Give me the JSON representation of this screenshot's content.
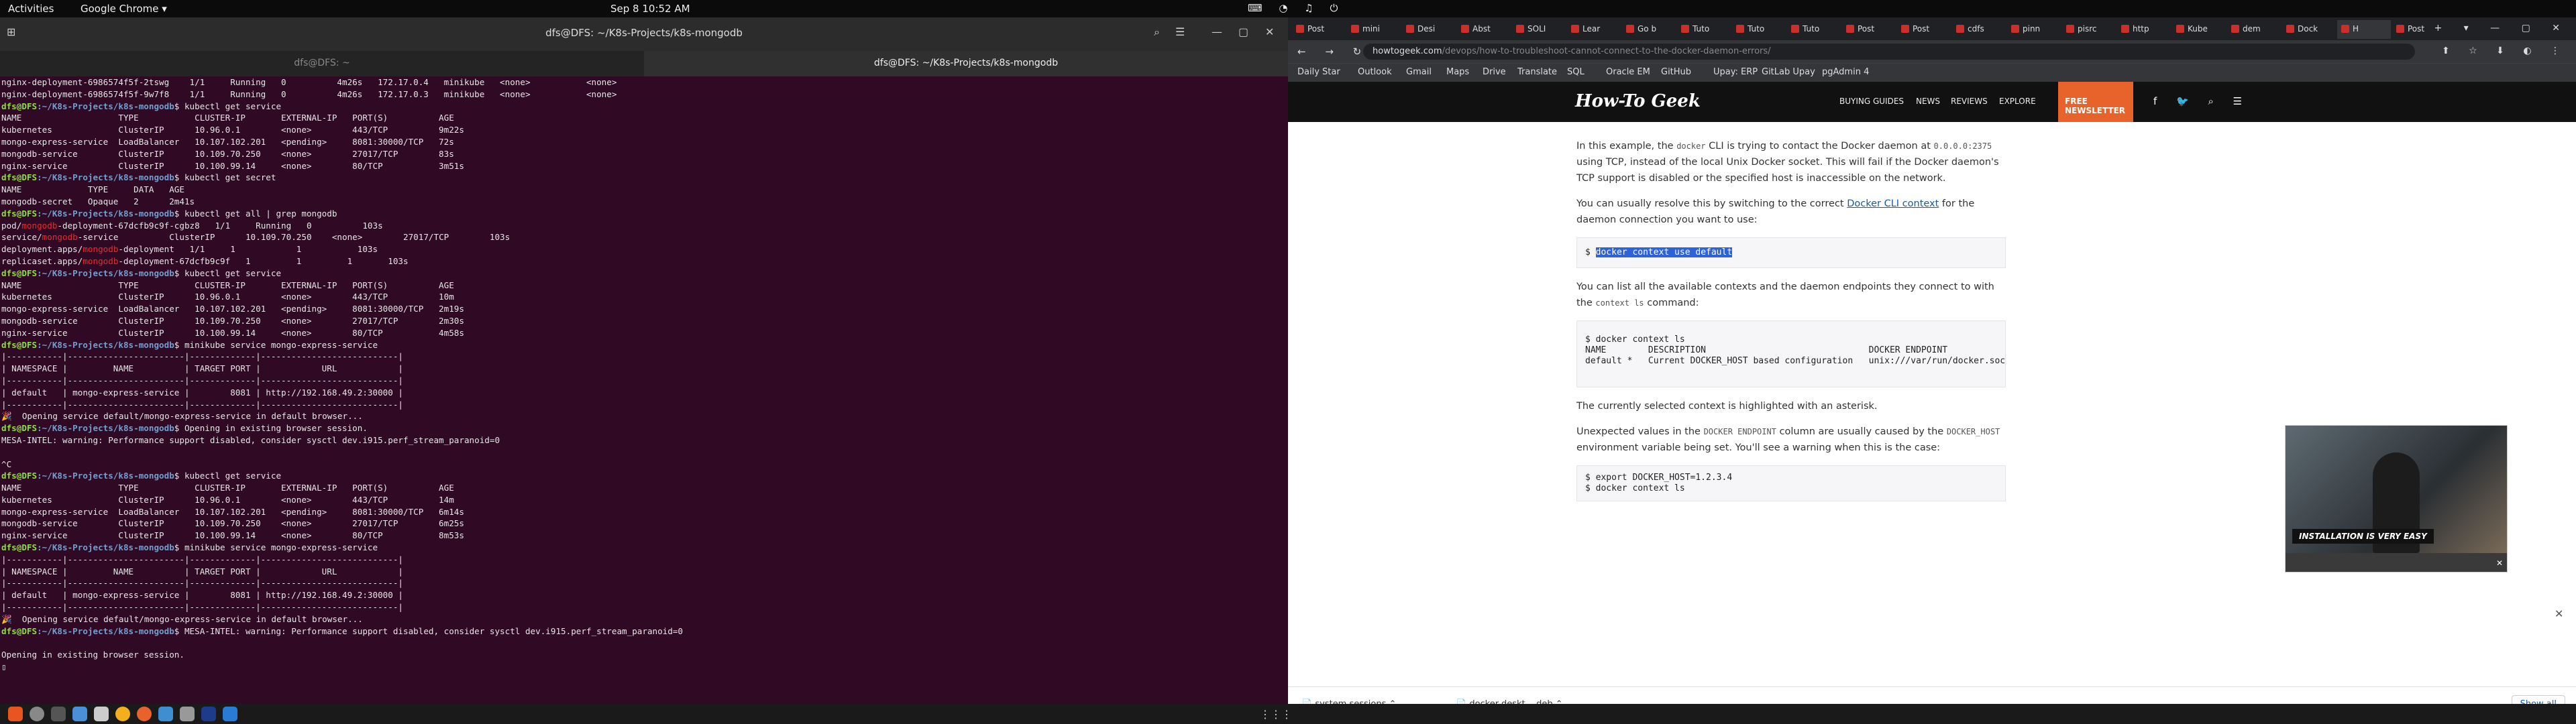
{
  "topbar": {
    "activities": "Activities",
    "app": "Google Chrome ▾",
    "clock": "Sep 8  10:52 AM"
  },
  "terminal": {
    "title": "dfs@DFS: ~/K8s-Projects/k8s-mongodb",
    "tab1": "dfs@DFS: ~",
    "tab2": "dfs@DFS: ~/K8s-Projects/k8s-mongodb",
    "lines": [
      {
        "t": "nginx-deployment-6986574f5f-2tswg    1/1     Running   0          4m26s   172.17.0.4   minikube   <none>           <none>"
      },
      {
        "t": "nginx-deployment-6986574f5f-9w7f8    1/1     Running   0          4m26s   172.17.0.3   minikube   <none>           <none>"
      },
      {
        "p": "kubectl get service"
      },
      {
        "t": "NAME                   TYPE           CLUSTER-IP       EXTERNAL-IP   PORT(S)          AGE"
      },
      {
        "t": "kubernetes             ClusterIP      10.96.0.1        <none>        443/TCP          9m22s"
      },
      {
        "t": "mongo-express-service  LoadBalancer   10.107.102.201   <pending>     8081:30000/TCP   72s"
      },
      {
        "t": "mongodb-service        ClusterIP      10.109.70.250    <none>        27017/TCP        83s"
      },
      {
        "t": "nginx-service          ClusterIP      10.100.99.14     <none>        80/TCP           3m51s"
      },
      {
        "p": "kubectl get secret"
      },
      {
        "t": "NAME             TYPE     DATA   AGE"
      },
      {
        "t": "mongodb-secret   Opaque   2      2m41s"
      },
      {
        "p": "kubectl get all | grep mongodb"
      },
      {
        "a": "pod/",
        "h": "mongodb",
        "b": "-deployment-67dcfb9c9f-cgbz8   1/1     Running   0          103s"
      },
      {
        "a": "service/",
        "h": "mongodb",
        "b": "-service          ClusterIP      10.109.70.250    <none>        27017/TCP        103s"
      },
      {
        "a": "deployment.apps/",
        "h": "mongodb",
        "b": "-deployment   1/1     1            1           103s"
      },
      {
        "a": "replicaset.apps/",
        "h": "mongodb",
        "b": "-deployment-67dcfb9c9f   1         1         1       103s"
      },
      {
        "p": "kubectl get service"
      },
      {
        "t": "NAME                   TYPE           CLUSTER-IP       EXTERNAL-IP   PORT(S)          AGE"
      },
      {
        "t": "kubernetes             ClusterIP      10.96.0.1        <none>        443/TCP          10m"
      },
      {
        "t": "mongo-express-service  LoadBalancer   10.107.102.201   <pending>     8081:30000/TCP   2m19s"
      },
      {
        "t": "mongodb-service        ClusterIP      10.109.70.250    <none>        27017/TCP        2m30s"
      },
      {
        "t": "nginx-service          ClusterIP      10.100.99.14     <none>        80/TCP           4m58s"
      },
      {
        "p": "minikube service mongo-express-service"
      },
      {
        "t": "|-----------|-----------------------|-------------|---------------------------|"
      },
      {
        "t": "| NAMESPACE |         NAME          | TARGET PORT |            URL            |"
      },
      {
        "t": "|-----------|-----------------------|-------------|---------------------------|"
      },
      {
        "t": "| default   | mongo-express-service |        8081 | http://192.168.49.2:30000 |"
      },
      {
        "t": "|-----------|-----------------------|-------------|---------------------------|"
      },
      {
        "t": "🎉  Opening service default/mongo-express-service in default browser..."
      },
      {
        "p": "Opening in existing browser session."
      },
      {
        "t": "MESA-INTEL: warning: Performance support disabled, consider sysctl dev.i915.perf_stream_paranoid=0"
      },
      {
        "t": ""
      },
      {
        "t": "^C"
      },
      {
        "p": "kubectl get service"
      },
      {
        "t": "NAME                   TYPE           CLUSTER-IP       EXTERNAL-IP   PORT(S)          AGE"
      },
      {
        "t": "kubernetes             ClusterIP      10.96.0.1        <none>        443/TCP          14m"
      },
      {
        "t": "mongo-express-service  LoadBalancer   10.107.102.201   <pending>     8081:30000/TCP   6m14s"
      },
      {
        "t": "mongodb-service        ClusterIP      10.109.70.250    <none>        27017/TCP        6m25s"
      },
      {
        "t": "nginx-service          ClusterIP      10.100.99.14     <none>        80/TCP           8m53s"
      },
      {
        "p": "minikube service mongo-express-service"
      },
      {
        "t": "|-----------|-----------------------|-------------|---------------------------|"
      },
      {
        "t": "| NAMESPACE |         NAME          | TARGET PORT |            URL            |"
      },
      {
        "t": "|-----------|-----------------------|-------------|---------------------------|"
      },
      {
        "t": "| default   | mongo-express-service |        8081 | http://192.168.49.2:30000 |"
      },
      {
        "t": "|-----------|-----------------------|-------------|---------------------------|"
      },
      {
        "t": "🎉  Opening service default/mongo-express-service in default browser..."
      },
      {
        "p": "MESA-INTEL: warning: Performance support disabled, consider sysctl dev.i915.perf_stream_paranoid=0"
      },
      {
        "t": ""
      },
      {
        "t": "Opening in existing browser session."
      },
      {
        "t": "▯"
      }
    ],
    "prompt_user": "dfs@DFS",
    "prompt_path": ":~/K8s-Projects/k8s-mongodb",
    "prompt_sigil": "$ "
  },
  "browser": {
    "tabs": [
      "Post",
      "mini",
      "Desi",
      "Abst",
      "SOLI",
      "Lear",
      "Go b",
      "Tuto",
      "Tuto",
      "Tuto",
      "Post",
      "Post",
      "cdfs",
      "pinn",
      "pisrc",
      "http",
      "Kube",
      "dem",
      "Dock",
      "H",
      "Post"
    ],
    "url_domain": "howtogeek.com",
    "url_path": "/devops/how-to-troubleshoot-cannot-connect-to-the-docker-daemon-errors/",
    "bookmarks": [
      "Daily Star",
      "Outlook",
      "Gmail",
      "Maps",
      "Drive",
      "Translate",
      "SQL",
      "Oracle EM",
      "GitHub",
      "Upay: ERP",
      "GitLab Upay",
      "pgAdmin 4"
    ],
    "site": {
      "logo": "How-To Geek",
      "nav": [
        "BUYING GUIDES",
        "NEWS",
        "REVIEWS",
        "EXPLORE"
      ],
      "newsletter": "FREE NEWSLETTER"
    },
    "article": {
      "p1a": "In this example, the ",
      "p1c1": "docker",
      "p1b": " CLI is trying to contact the Docker daemon at ",
      "p1c2": "0.0.0.0:2375",
      "p1d": " using TCP, instead of the local Unix Docker socket. This will fail if the Docker daemon's TCP support is disabled or the specified host is inaccessible on the network.",
      "p2a": "You can usually resolve this by switching to the correct ",
      "p2link": "Docker CLI context",
      "p2b": " for the daemon connection you want to use:",
      "code1_prefix": "$ ",
      "code1": "docker context use default",
      "p3a": "You can list all the available contexts and the daemon endpoints they connect to with the ",
      "p3c": "context ls",
      "p3b": " command:",
      "code2": "$ docker context ls\nNAME        DESCRIPTION                               DOCKER ENDPOINT\ndefault *   Current DOCKER_HOST based configuration   unix:///var/run/docker.sock",
      "p4": "The currently selected context is highlighted with an asterisk.",
      "p5a": "Unexpected values in the ",
      "p5c1": "DOCKER ENDPOINT",
      "p5b": " column are usually caused by the ",
      "p5c2": "DOCKER_HOST",
      "p5d": " environment variable being set. You'll see a warning when this is the case:",
      "code3": "$ export DOCKER_HOST=1.2.3.4\n$ docker context ls"
    },
    "video_caption": "INSTALLATION IS VERY EASY",
    "downloads": [
      "system.sessions",
      "docker-deskt....deb"
    ],
    "show_all": "Show all"
  }
}
